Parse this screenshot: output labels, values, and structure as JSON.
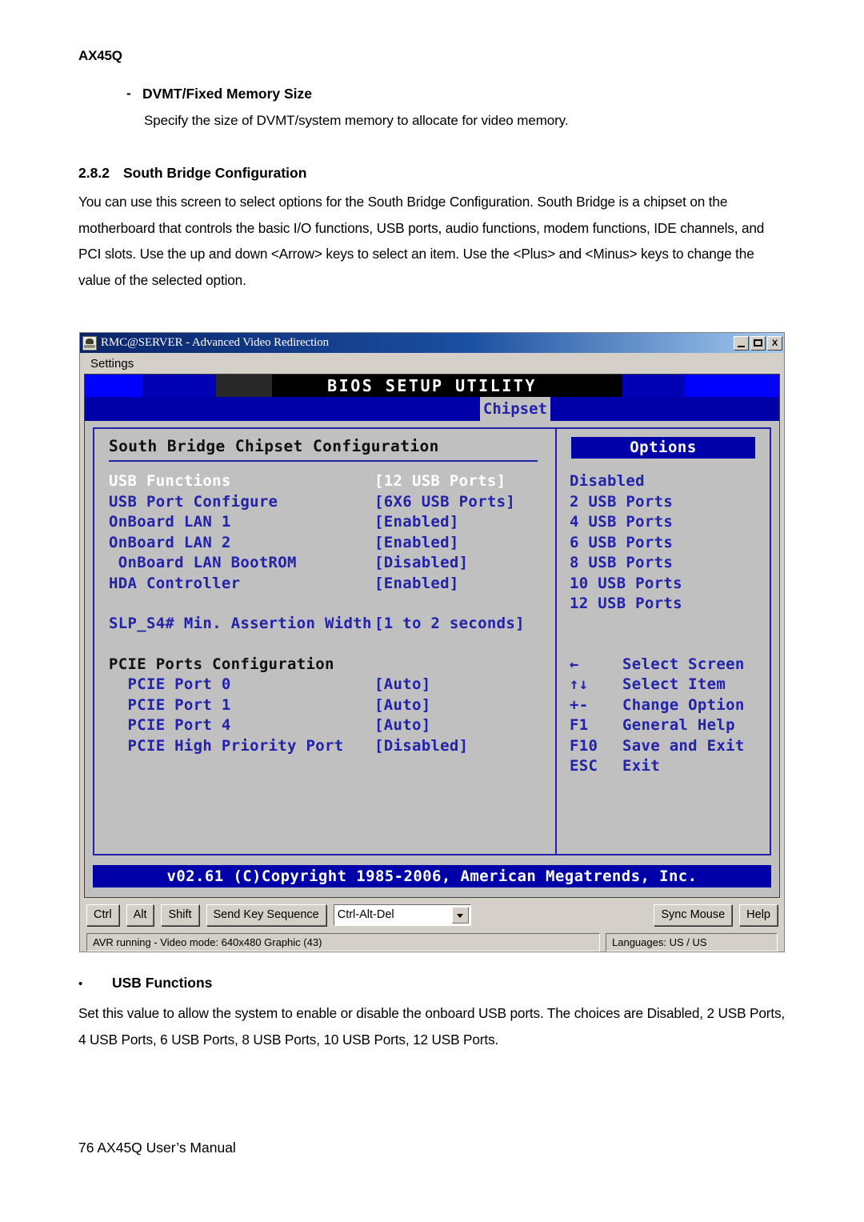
{
  "document": {
    "page_header": "AX45Q",
    "dvmt_bullet_mark": "-",
    "dvmt_bullet_label": "DVMT/Fixed Memory Size",
    "dvmt_description": "Specify the size of DVMT/system memory to allocate for video memory.",
    "section_number": "2.8.2",
    "section_title": "South Bridge Configuration",
    "intro_paragraph": "You can use this screen to select options for the South Bridge Configuration. South Bridge is a chipset on the motherboard that controls the basic I/O functions, USB ports, audio functions, modem functions, IDE channels, and PCI slots. Use the up and down <Arrow> keys to select an item. Use the <Plus> and <Minus> keys to change the value of the selected option.",
    "usb_bullet_mark": "•",
    "usb_bullet_label": "USB Functions",
    "usb_paragraph": "Set this value to allow the system to enable or disable the onboard USB ports. The choices are Disabled, 2 USB Ports, 4 USB Ports, 6 USB Ports, 8 USB Ports, 10 USB Ports, 12 USB Ports.",
    "footer": "76 AX45Q User’s Manual"
  },
  "avr_window": {
    "title": "RMC@SERVER - Advanced Video Redirection",
    "window_buttons": {
      "minimize": "_",
      "maximize": "□",
      "close": "X"
    },
    "menu": {
      "settings": "Settings"
    }
  },
  "bios": {
    "title": "BIOS SETUP UTILITY",
    "active_tab": "Chipset",
    "panel_title": "South Bridge Chipset Configuration",
    "settings": [
      {
        "key": "USB Functions",
        "value": "[12 USB Ports]",
        "selected": true
      },
      {
        "key": "USB Port Configure",
        "value": "[6X6 USB Ports]",
        "selected": false
      },
      {
        "key": "OnBoard LAN 1",
        "value": "[Enabled]",
        "selected": false
      },
      {
        "key": "OnBoard LAN 2",
        "value": "[Enabled]",
        "selected": false
      },
      {
        "key": " OnBoard LAN BootROM",
        "value": "[Disabled]",
        "selected": false
      },
      {
        "key": "HDA Controller",
        "value": "[Enabled]",
        "selected": false
      }
    ],
    "slp_setting": {
      "key": "SLP_S4# Min. Assertion Width",
      "value": "[1 to 2 seconds]"
    },
    "pcie_group_title": "PCIE Ports Configuration",
    "pcie_settings": [
      {
        "key": "  PCIE Port 0",
        "value": "[Auto]"
      },
      {
        "key": "  PCIE Port 1",
        "value": "[Auto]"
      },
      {
        "key": "  PCIE Port 4",
        "value": "[Auto]"
      },
      {
        "key": "  PCIE High Priority Port",
        "value": "[Disabled]"
      }
    ],
    "options_header": "Options",
    "options": [
      "Disabled",
      "2 USB Ports",
      "4 USB Ports",
      "6 USB Ports",
      "8 USB Ports",
      "10 USB Ports",
      "12 USB Ports"
    ],
    "help_keys": [
      {
        "key": "←",
        "label": "Select Screen"
      },
      {
        "key": "↑↓",
        "label": "Select Item"
      },
      {
        "key": "+-",
        "label": "Change Option"
      },
      {
        "key": "F1",
        "label": "General Help"
      },
      {
        "key": "F10",
        "label": "Save and Exit"
      },
      {
        "key": "ESC",
        "label": "Exit"
      }
    ],
    "copyright": "v02.61 (C)Copyright 1985-2006, American Megatrends, Inc.",
    "colors": {
      "screen_bg": "#c0c0c0",
      "text_blue": "#2222aa",
      "bar_blue": "#0000a8",
      "selected_text": "#ffffff"
    }
  },
  "toolbar": {
    "ctrl": "Ctrl",
    "alt": "Alt",
    "shift": "Shift",
    "send_key_sequence": "Send Key Sequence",
    "key_sequence_value": "Ctrl-Alt-Del",
    "sync_mouse": "Sync Mouse",
    "help": "Help"
  },
  "statusbar": {
    "left": "AVR running - Video mode: 640x480 Graphic (43)",
    "right": "Languages: US / US"
  }
}
